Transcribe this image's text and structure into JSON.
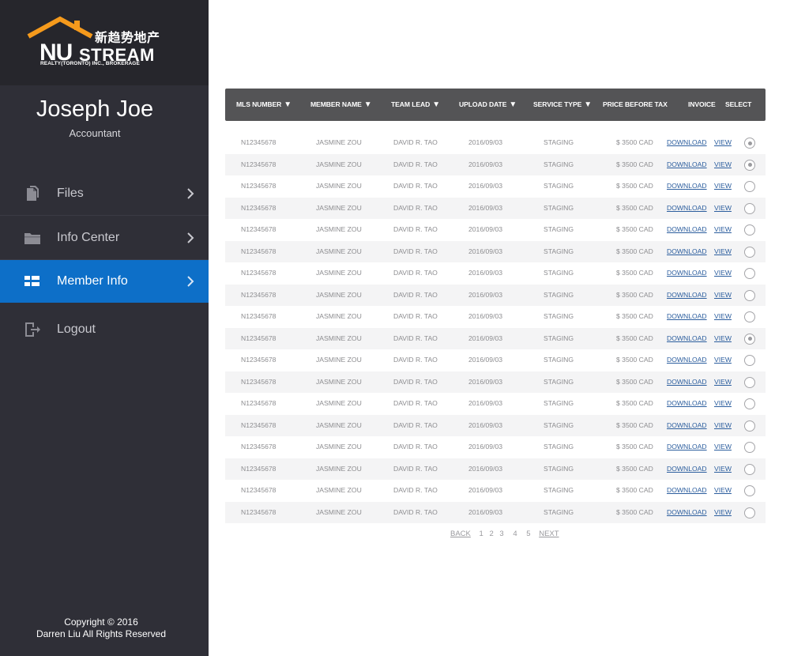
{
  "brand": {
    "chinese": "新趋势地产",
    "nu": "NU",
    "stream": "STREAM",
    "subtitle": "REALTY(TORONTO) INC., BROKERAGE",
    "colors": {
      "roof": "#f59a1c",
      "sidebar": "#2f2f37",
      "accent": "#0d6fc8"
    }
  },
  "user": {
    "name": "Joseph Joe",
    "role": "Accountant"
  },
  "nav": [
    {
      "label": "Files",
      "icon": "files-icon",
      "active": false
    },
    {
      "label": "Info Center",
      "icon": "folder-icon",
      "active": false
    },
    {
      "label": "Member Info",
      "icon": "grid-icon",
      "active": true
    },
    {
      "label": "Logout",
      "icon": "logout-icon",
      "active": false
    }
  ],
  "footer": {
    "line1": "Copyright © 2016",
    "line2": "Darren Liu All Rights Reserved"
  },
  "table": {
    "headers": {
      "mls": "MLS NUMBER",
      "member": "MEMBER NAME",
      "lead": "TEAM LEAD",
      "date": "UPLOAD DATE",
      "service": "SERVICE TYPE",
      "price": "PRICE BEFORE TAX",
      "invoice": "INVOICE",
      "select": "SELECT"
    },
    "rows": [
      {
        "mls": "N12345678",
        "member": "JASMINE ZOU",
        "lead": "DAVID R. TAO",
        "date": "2016/09/03",
        "service": "STAGING",
        "price": "$ 3500  CAD",
        "download": "DOWNLOAD",
        "view": "VIEW",
        "selected": true
      },
      {
        "mls": "N12345678",
        "member": "JASMINE ZOU",
        "lead": "DAVID R. TAO",
        "date": "2016/09/03",
        "service": "STAGING",
        "price": "$ 3500  CAD",
        "download": "DOWNLOAD",
        "view": "VIEW",
        "selected": true
      },
      {
        "mls": "N12345678",
        "member": "JASMINE ZOU",
        "lead": "DAVID R. TAO",
        "date": "2016/09/03",
        "service": "STAGING",
        "price": "$ 3500  CAD",
        "download": "DOWNLOAD",
        "view": "VIEW",
        "selected": false
      },
      {
        "mls": "N12345678",
        "member": "JASMINE ZOU",
        "lead": "DAVID R. TAO",
        "date": "2016/09/03",
        "service": "STAGING",
        "price": "$ 3500  CAD",
        "download": "DOWNLOAD",
        "view": "VIEW",
        "selected": false
      },
      {
        "mls": "N12345678",
        "member": "JASMINE ZOU",
        "lead": "DAVID R. TAO",
        "date": "2016/09/03",
        "service": "STAGING",
        "price": "$ 3500  CAD",
        "download": "DOWNLOAD",
        "view": "VIEW",
        "selected": false
      },
      {
        "mls": "N12345678",
        "member": "JASMINE ZOU",
        "lead": "DAVID R. TAO",
        "date": "2016/09/03",
        "service": "STAGING",
        "price": "$ 3500  CAD",
        "download": "DOWNLOAD",
        "view": "VIEW",
        "selected": false
      },
      {
        "mls": "N12345678",
        "member": "JASMINE ZOU",
        "lead": "DAVID R. TAO",
        "date": "2016/09/03",
        "service": "STAGING",
        "price": "$ 3500  CAD",
        "download": "DOWNLOAD",
        "view": "VIEW",
        "selected": false
      },
      {
        "mls": "N12345678",
        "member": "JASMINE ZOU",
        "lead": "DAVID R. TAO",
        "date": "2016/09/03",
        "service": "STAGING",
        "price": "$ 3500  CAD",
        "download": "DOWNLOAD",
        "view": "VIEW",
        "selected": false
      },
      {
        "mls": "N12345678",
        "member": "JASMINE ZOU",
        "lead": "DAVID R. TAO",
        "date": "2016/09/03",
        "service": "STAGING",
        "price": "$ 3500  CAD",
        "download": "DOWNLOAD",
        "view": "VIEW",
        "selected": false
      },
      {
        "mls": "N12345678",
        "member": "JASMINE ZOU",
        "lead": "DAVID R. TAO",
        "date": "2016/09/03",
        "service": "STAGING",
        "price": "$ 3500  CAD",
        "download": "DOWNLOAD",
        "view": "VIEW",
        "selected": true
      },
      {
        "mls": "N12345678",
        "member": "JASMINE ZOU",
        "lead": "DAVID R. TAO",
        "date": "2016/09/03",
        "service": "STAGING",
        "price": "$ 3500  CAD",
        "download": "DOWNLOAD",
        "view": "VIEW",
        "selected": false
      },
      {
        "mls": "N12345678",
        "member": "JASMINE ZOU",
        "lead": "DAVID R. TAO",
        "date": "2016/09/03",
        "service": "STAGING",
        "price": "$ 3500  CAD",
        "download": "DOWNLOAD",
        "view": "VIEW",
        "selected": false
      },
      {
        "mls": "N12345678",
        "member": "JASMINE ZOU",
        "lead": "DAVID R. TAO",
        "date": "2016/09/03",
        "service": "STAGING",
        "price": "$ 3500  CAD",
        "download": "DOWNLOAD",
        "view": "VIEW",
        "selected": false
      },
      {
        "mls": "N12345678",
        "member": "JASMINE ZOU",
        "lead": "DAVID R. TAO",
        "date": "2016/09/03",
        "service": "STAGING",
        "price": "$ 3500  CAD",
        "download": "DOWNLOAD",
        "view": "VIEW",
        "selected": false
      },
      {
        "mls": "N12345678",
        "member": "JASMINE ZOU",
        "lead": "DAVID R. TAO",
        "date": "2016/09/03",
        "service": "STAGING",
        "price": "$ 3500  CAD",
        "download": "DOWNLOAD",
        "view": "VIEW",
        "selected": false
      },
      {
        "mls": "N12345678",
        "member": "JASMINE ZOU",
        "lead": "DAVID R. TAO",
        "date": "2016/09/03",
        "service": "STAGING",
        "price": "$ 3500  CAD",
        "download": "DOWNLOAD",
        "view": "VIEW",
        "selected": false
      },
      {
        "mls": "N12345678",
        "member": "JASMINE ZOU",
        "lead": "DAVID R. TAO",
        "date": "2016/09/03",
        "service": "STAGING",
        "price": "$ 3500  CAD",
        "download": "DOWNLOAD",
        "view": "VIEW",
        "selected": false
      },
      {
        "mls": "N12345678",
        "member": "JASMINE ZOU",
        "lead": "DAVID R. TAO",
        "date": "2016/09/03",
        "service": "STAGING",
        "price": "$ 3500  CAD",
        "download": "DOWNLOAD",
        "view": "VIEW",
        "selected": false
      }
    ]
  },
  "pagination": {
    "back": "BACK",
    "pages": [
      "1",
      "2",
      "3",
      "4",
      "5"
    ],
    "next": "NEXT"
  }
}
